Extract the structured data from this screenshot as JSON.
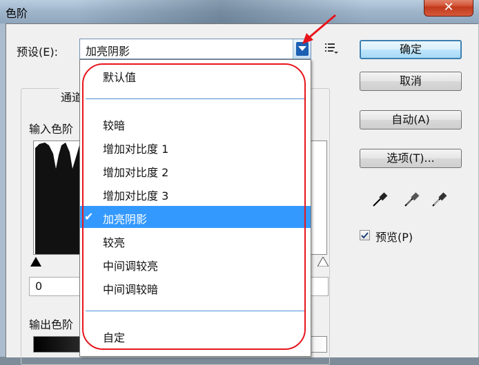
{
  "window": {
    "title": "色阶",
    "close_symbol": "✕"
  },
  "preset": {
    "label": "预设(E):",
    "value": "加亮阴影"
  },
  "group": {
    "channel_label": "通道",
    "input_levels_label": "输入色阶",
    "output_levels_label": "输出色阶",
    "input_black": "0"
  },
  "buttons": {
    "ok": "确定",
    "cancel": "取消",
    "auto": "自动(A)",
    "options": "选项(T)..."
  },
  "preview": {
    "label": "预览(P)",
    "checked": true
  },
  "dropdown": {
    "items": [
      {
        "label": "默认值",
        "selected": false
      },
      {
        "label": "较暗",
        "selected": false
      },
      {
        "label": "增加对比度 1",
        "selected": false
      },
      {
        "label": "增加对比度 2",
        "selected": false
      },
      {
        "label": "增加对比度 3",
        "selected": false
      },
      {
        "label": "加亮阴影",
        "selected": true
      },
      {
        "label": "较亮",
        "selected": false
      },
      {
        "label": "中间调较亮",
        "selected": false
      },
      {
        "label": "中间调较暗",
        "selected": false
      },
      {
        "label": "自定",
        "selected": false
      }
    ],
    "check_symbol": "✔"
  },
  "colors": {
    "selection": "#3399ff",
    "annotation_red": "#e8141c",
    "default_button_border": "#3c7fb1"
  },
  "icons": [
    "close-icon",
    "dropdown-arrow-icon",
    "preset-menu-icon",
    "eyedropper-black-icon",
    "eyedropper-gray-icon",
    "eyedropper-white-icon",
    "red-annotation-arrow-icon",
    "checkmark-icon"
  ]
}
